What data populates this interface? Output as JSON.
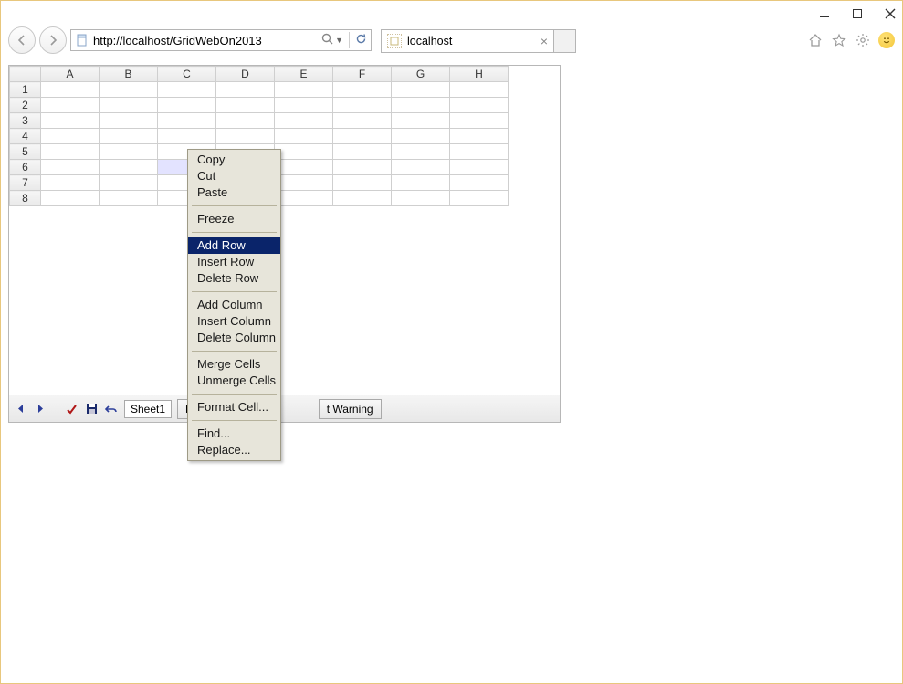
{
  "window": {
    "minimize_label": "Minimize",
    "maximize_label": "Maximize",
    "close_label": "Close"
  },
  "browser": {
    "url": "http://localhost/GridWebOn2013",
    "tab_title": "localhost",
    "icons": {
      "home": "home-icon",
      "favorites": "star-icon",
      "tools": "gear-icon",
      "feedback": "smiley-icon"
    }
  },
  "grid": {
    "columns": [
      "A",
      "B",
      "C",
      "D",
      "E",
      "F",
      "G",
      "H"
    ],
    "rows": [
      "1",
      "2",
      "3",
      "4",
      "5",
      "6",
      "7",
      "8"
    ],
    "selected_cell": {
      "row": 5,
      "col": 2
    },
    "sheet_name": "Sheet1",
    "footer": {
      "button1_partial": "Eva",
      "button2_partial": "t Warning"
    }
  },
  "context_menu": {
    "groups": [
      [
        "Copy",
        "Cut",
        "Paste"
      ],
      [
        "Freeze"
      ],
      [
        "Add Row",
        "Insert Row",
        "Delete Row"
      ],
      [
        "Add Column",
        "Insert Column",
        "Delete Column"
      ],
      [
        "Merge Cells",
        "Unmerge Cells"
      ],
      [
        "Format Cell..."
      ],
      [
        "Find...",
        "Replace..."
      ]
    ],
    "highlighted": "Add Row"
  }
}
